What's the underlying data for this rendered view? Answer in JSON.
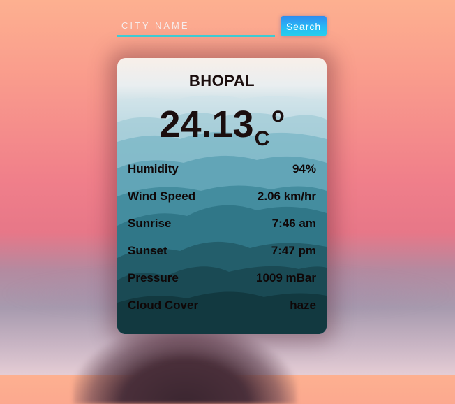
{
  "search": {
    "placeholder": "CITY NAME",
    "button_label": "Search"
  },
  "weather": {
    "city": "BHOPAL",
    "temperature": "24.13",
    "unit": "C",
    "degree_symbol": "o",
    "details": [
      {
        "label": "Humidity",
        "value": "94%"
      },
      {
        "label": "Wind Speed",
        "value": "2.06 km/hr"
      },
      {
        "label": "Sunrise",
        "value": "7:46 am"
      },
      {
        "label": "Sunset",
        "value": "7:47 pm"
      },
      {
        "label": "Pressure",
        "value": "1009 mBar"
      },
      {
        "label": "Cloud Cover",
        "value": "haze"
      }
    ]
  },
  "colors": {
    "accent_underline": "#3fd0d8",
    "button_gradient_top": "#2f8cf0",
    "button_gradient_bottom": "#25d5f0",
    "text_dark": "#1b0e0e"
  }
}
